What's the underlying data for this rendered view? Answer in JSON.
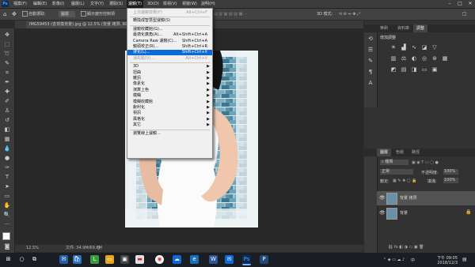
{
  "app": {
    "logo": "Ps"
  },
  "menubar": {
    "items": [
      "檔案(F)",
      "編輯(E)",
      "影像(I)",
      "圖層(L)",
      "文字(Y)",
      "選取(S)",
      "濾鏡(T)",
      "3D(D)",
      "檢視(V)",
      "視窗(W)",
      "說明(H)"
    ],
    "active_index": 6
  },
  "optbar": {
    "auto_select": "自動選取:",
    "layer": "圖層",
    "show_transform": "顯示變形控制項",
    "mode3d": "3D 模式:"
  },
  "document": {
    "tab_title": "IMG59453 (去背換背景).jpg @ 12.5% (背景 拷貝, RGB/8)"
  },
  "status": {
    "zoom": "12.5%",
    "doc_size": "文件: 34.9M/69.8M"
  },
  "filter_menu": [
    {
      "label": "上次濾鏡效果(F)",
      "shortcut": "Alt+Ctrl+F",
      "state": "disabled"
    },
    {
      "sep": true
    },
    {
      "label": "轉換成智慧型濾鏡(S)",
      "shortcut": "",
      "state": "normal"
    },
    {
      "sep": true
    },
    {
      "label": "濾鏡收藏館(G)...",
      "shortcut": "",
      "state": "normal"
    },
    {
      "label": "最適化廣角(A)...",
      "shortcut": "Alt+Shift+Ctrl+A",
      "state": "normal"
    },
    {
      "label": "Camera Raw 濾鏡(C)...",
      "shortcut": "Shift+Ctrl+A",
      "state": "normal"
    },
    {
      "label": "鏡頭校正(R)...",
      "shortcut": "Shift+Ctrl+R",
      "state": "normal"
    },
    {
      "label": "液化(L)...",
      "shortcut": "Shift+Ctrl+X",
      "state": "highlighted"
    },
    {
      "label": "消失點(V)...",
      "shortcut": "Alt+Ctrl+V",
      "state": "disabled"
    },
    {
      "sep": true
    },
    {
      "label": "3D",
      "submenu": true,
      "state": "normal"
    },
    {
      "label": "扭曲",
      "submenu": true,
      "state": "normal"
    },
    {
      "label": "雜訊",
      "submenu": true,
      "state": "normal"
    },
    {
      "label": "像素化",
      "submenu": true,
      "state": "normal"
    },
    {
      "label": "演算上色",
      "submenu": true,
      "state": "normal"
    },
    {
      "label": "模糊",
      "submenu": true,
      "state": "normal"
    },
    {
      "label": "模糊收藏館",
      "submenu": true,
      "state": "normal"
    },
    {
      "label": "銳利化",
      "submenu": true,
      "state": "normal"
    },
    {
      "label": "視訊",
      "submenu": true,
      "state": "normal"
    },
    {
      "label": "風格化",
      "submenu": true,
      "state": "normal"
    },
    {
      "label": "其它",
      "submenu": true,
      "state": "normal"
    },
    {
      "sep": true
    },
    {
      "label": "瀏覽線上濾鏡...",
      "shortcut": "",
      "state": "normal"
    }
  ],
  "right_panel": {
    "top_tabs": [
      "筆刷",
      "資料庫",
      "調整"
    ],
    "adjust_title": "增加調整",
    "layer_tabs": [
      "圖層",
      "色版",
      "路徑"
    ],
    "kind": "種類",
    "blend": "正常",
    "opacity_label": "不透明度:",
    "opacity": "100%",
    "lock_label": "鎖定:",
    "fill_label": "填滿:",
    "fill": "100%",
    "layers": [
      {
        "name": "背景 拷貝",
        "selected": true
      },
      {
        "name": "背景",
        "selected": false
      }
    ]
  },
  "taskbar": {
    "time": "下午 09:05",
    "date": "2018/12/3",
    "ime": "中",
    "icon_names": [
      "windows-icon",
      "cortana-icon",
      "task-view-icon",
      "mail-icon",
      "store-icon",
      "line-icon",
      "folder-icon",
      "chrome-icon",
      "onedrive-icon",
      "explorer-icon",
      "word-icon",
      "mail2-icon",
      "photoshop-icon",
      "app2-icon"
    ]
  },
  "colors": {
    "accent": "#0b6ad6",
    "ps_blue": "#31a8ff"
  }
}
